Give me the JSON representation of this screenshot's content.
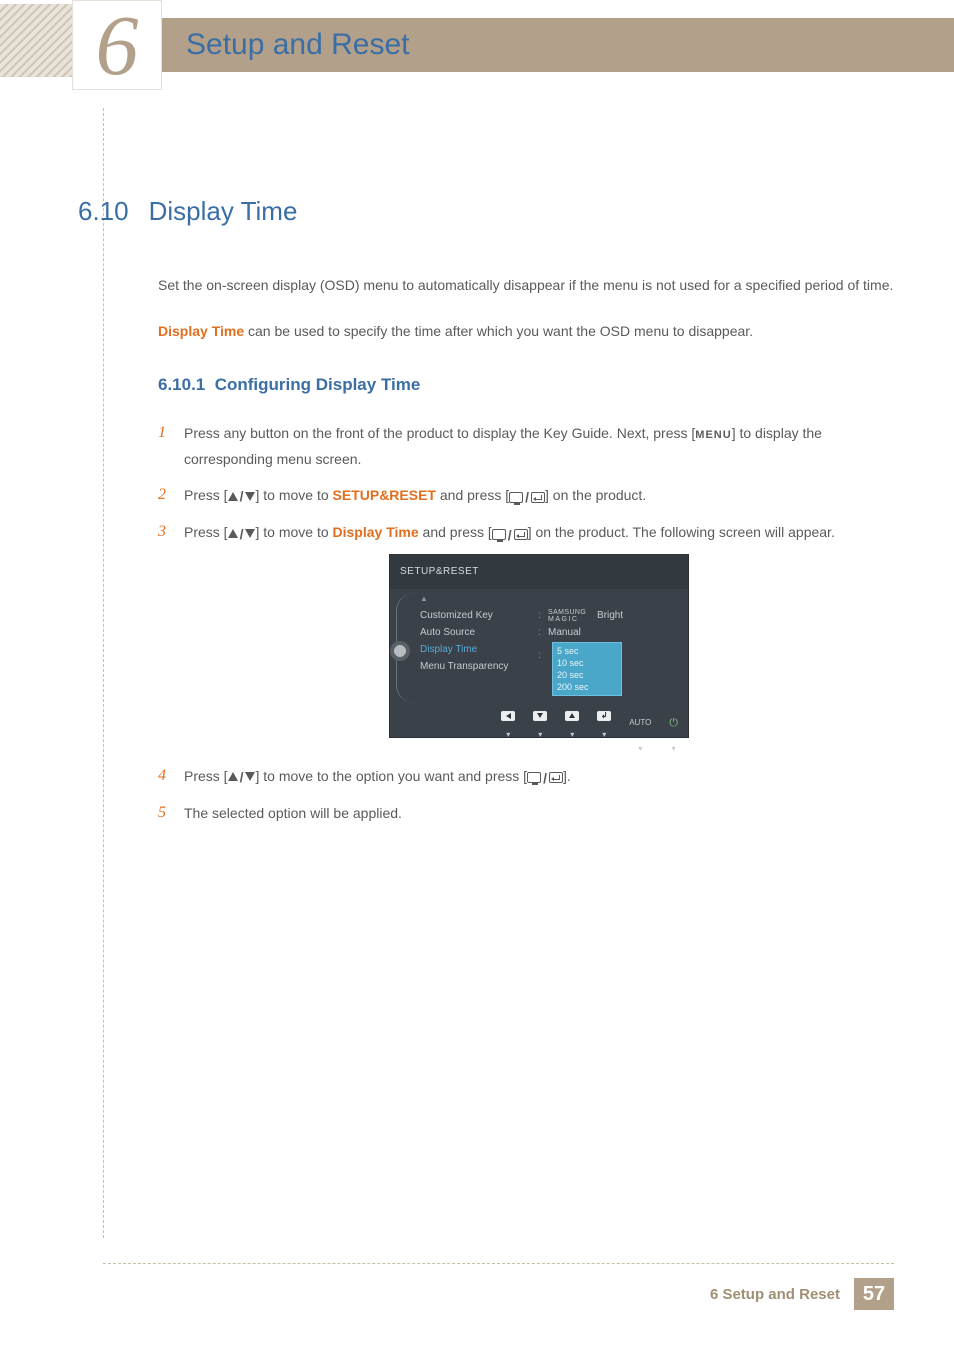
{
  "chapter": {
    "number": "6",
    "title": "Setup and Reset"
  },
  "section": {
    "number": "6.10",
    "title": "Display Time"
  },
  "intro_para": "Set the on-screen display (OSD) menu to automatically disappear if the menu is not used for a specified period of time.",
  "second_para_kw": "Display Time",
  "second_para_rest": " can be used to specify the time after which you want the OSD menu to disappear.",
  "subsection": {
    "number": "6.10.1",
    "title": "Configuring Display Time"
  },
  "steps": {
    "s1": {
      "num": "1",
      "a": "Press any button on the front of the product to display the Key Guide. Next, press [",
      "menu": "MENU",
      "b": "] to display the corresponding menu screen."
    },
    "s2": {
      "num": "2",
      "a": "Press [",
      "b": "] to move to ",
      "kw": "SETUP&RESET",
      "c": " and press [",
      "d": "] on the product."
    },
    "s3": {
      "num": "3",
      "a": "Press [",
      "b": "] to move to ",
      "kw": "Display Time",
      "c": " and press [",
      "d": "] on the product. The following screen will appear."
    },
    "s4": {
      "num": "4",
      "a": "Press [",
      "b": "] to move to the option you want and press [",
      "c": "]."
    },
    "s5": {
      "num": "5",
      "text": "The selected option will be applied."
    }
  },
  "osd": {
    "title": "SETUP&RESET",
    "items": {
      "customized_key": "Customized Key",
      "auto_source": "Auto Source",
      "display_time": "Display Time",
      "menu_transparency": "Menu Transparency"
    },
    "values": {
      "samsung": "SAMSUNG",
      "magic": "MAGIC",
      "bright": "Bright",
      "manual": "Manual"
    },
    "dropdown": [
      "5 sec",
      "10 sec",
      "20 sec",
      "200 sec"
    ],
    "footer_auto": "AUTO"
  },
  "footer": {
    "label": "6 Setup and Reset",
    "page": "57"
  }
}
